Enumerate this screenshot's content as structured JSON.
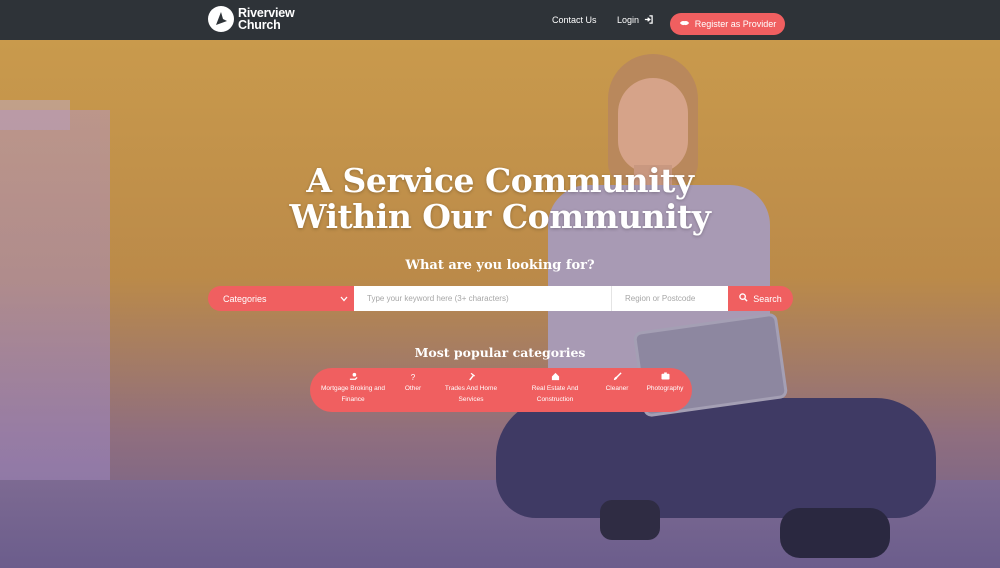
{
  "header": {
    "logo_line1": "Riverview",
    "logo_line2": "Church",
    "nav": {
      "contact": "Contact Us",
      "login": "Login"
    },
    "register_label": "Register as Provider"
  },
  "hero": {
    "headline_line1": "A Service Community",
    "headline_line2": "Within Our Community",
    "subhead": "What are you looking for?"
  },
  "search": {
    "category_selected": "Categories",
    "keyword_placeholder": "Type your keyword here (3+ characters)",
    "region_placeholder": "Region or Postcode",
    "button_label": "Search"
  },
  "popular": {
    "heading": "Most popular categories",
    "items": [
      {
        "label_line1": "Mortgage Broking and",
        "label_line2": "Finance",
        "icon": "hand-coin-icon"
      },
      {
        "label_line1": "Other",
        "label_line2": "",
        "icon": "question-icon"
      },
      {
        "label_line1": "Trades And Home",
        "label_line2": "Services",
        "icon": "hammer-icon"
      },
      {
        "label_line1": "Real Estate And",
        "label_line2": "Construction",
        "icon": "home-icon"
      },
      {
        "label_line1": "Cleaner",
        "label_line2": "",
        "icon": "brush-icon"
      },
      {
        "label_line1": "Photography",
        "label_line2": "",
        "icon": "camera-icon"
      }
    ]
  },
  "colors": {
    "accent": "#f05f60",
    "topbar": "#2e3338"
  }
}
